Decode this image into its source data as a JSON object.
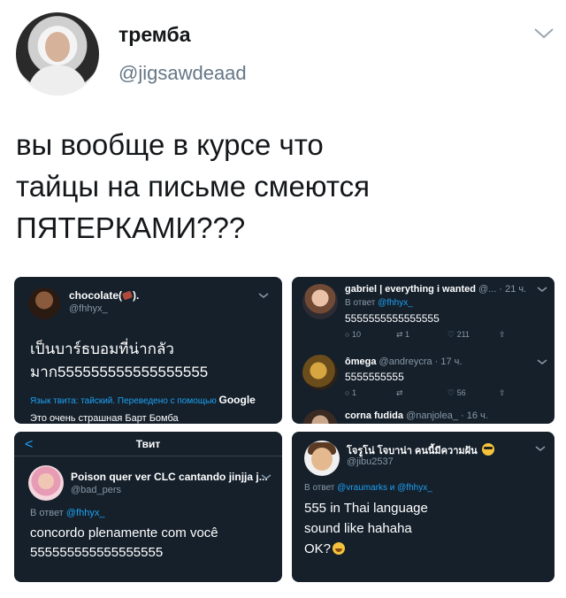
{
  "header": {
    "display_name": "тремба",
    "handle": "@jigsawdeaad"
  },
  "tweet": {
    "lines": [
      "вы вообще в курсе что",
      "тайцы на письме смеются",
      "ПЯТЕРКАМИ???"
    ]
  },
  "card1": {
    "name": "chocolate(",
    "name_suffix": ").",
    "handle": "@fhhyx_",
    "text1": "เป็นบาร์ธบอมที่น่ากลัว",
    "text2": "มาก555555555555555555",
    "translate_note": "Язык твита: тайский. Переведено с помощью",
    "translate_brand": "Google",
    "translation": "Это очень страшная Барт Бомба"
  },
  "card2": {
    "t1_name": "gabriel | everything i wanted",
    "t1_meta": "@... · 21 ч.",
    "t1_reply_prefix": "В ответ",
    "t1_reply_to": "@fhhyx_",
    "t1_text": "5555555555555555",
    "t1_counts": [
      "10",
      "1",
      "211"
    ],
    "t2_name": "ômega",
    "t2_meta": "@andreycra · 17 ч.",
    "t2_text": "5555555555",
    "t2_counts": [
      "1",
      "",
      "56"
    ],
    "t3_name": "corna fudida",
    "t3_meta": "@nanjolea_ · 16 ч."
  },
  "card3": {
    "back": "<",
    "title": "Твит",
    "name": "Poison quer ver CLC cantando jinjja j...",
    "handle": "@bad_pers",
    "reply_prefix": "В ответ",
    "reply_to": "@fhhyx_",
    "text1": "concordo plenamente com você",
    "text2": "555555555555555555"
  },
  "card4": {
    "name": "โจรูโน่ โจบาน่า คนนี้มีความฝัน",
    "handle": "@jibu2537",
    "reply_prefix": "В ответ",
    "reply_to": "@vraumarks и @fhhyx_",
    "text1": "555 in Thai language",
    "text2": "sound like hahaha",
    "text3": "OK?"
  },
  "icons": {
    "header_chevron": "chevron-down-icon",
    "reply": "reply-icon",
    "retweet": "retweet-icon",
    "like": "heart-icon",
    "share": "share-icon"
  },
  "colors": {
    "dark_card": "#15202b",
    "link": "#1da1f2",
    "muted": "#8899a6",
    "handle_gray": "#657786"
  }
}
